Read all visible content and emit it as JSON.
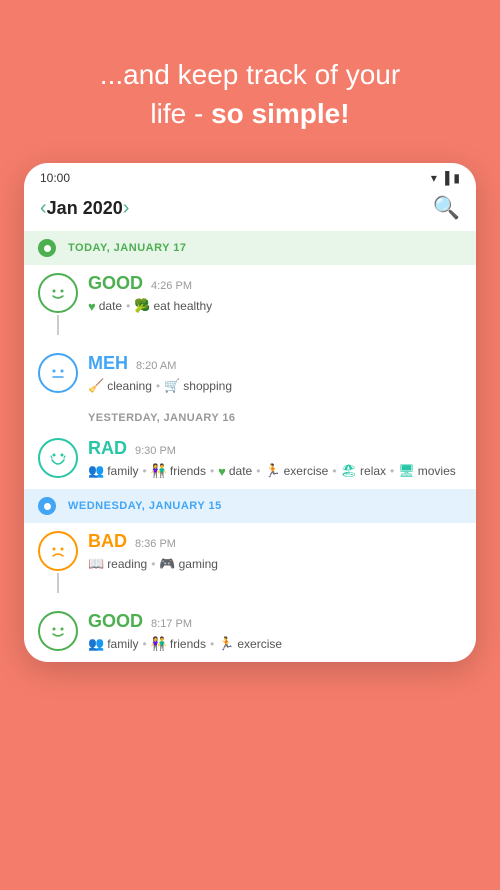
{
  "header": {
    "line1": "...and keep track of your",
    "line2_normal": "life - ",
    "line2_bold": "so simple!"
  },
  "statusBar": {
    "time": "10:00",
    "icons": [
      "wifi",
      "signal",
      "battery"
    ]
  },
  "navBar": {
    "prevLabel": "‹",
    "title": "Jan 2020",
    "nextLabel": "›",
    "searchIcon": "🔍"
  },
  "days": [
    {
      "id": "today",
      "type": "today",
      "label": "TODAY, JANUARY 17",
      "dotColor": "green",
      "entries": [
        {
          "mood": "GOOD",
          "moodClass": "good",
          "time": "4:26 PM",
          "tags": [
            {
              "icon": "♥",
              "iconClass": "green",
              "label": "date"
            },
            {
              "icon": "🥦",
              "iconClass": "green",
              "label": "eat healthy"
            }
          ],
          "hasConnector": true
        },
        {
          "mood": "MEH",
          "moodClass": "meh",
          "time": "8:20 AM",
          "tags": [
            {
              "icon": "🧹",
              "iconClass": "teal",
              "label": "cleaning"
            },
            {
              "icon": "🛒",
              "iconClass": "teal",
              "label": "shopping"
            }
          ],
          "hasConnector": false
        }
      ]
    },
    {
      "id": "yesterday",
      "type": "yesterday",
      "label": "YESTERDAY, JANUARY 16",
      "entries": [
        {
          "mood": "RAD",
          "moodClass": "rad",
          "time": "9:30 PM",
          "tags": [
            {
              "icon": "👥",
              "iconClass": "teal",
              "label": "family"
            },
            {
              "icon": "👫",
              "iconClass": "teal",
              "label": "friends"
            },
            {
              "icon": "♥",
              "iconClass": "green",
              "label": "date"
            },
            {
              "icon": "🏃",
              "iconClass": "teal",
              "label": "exercise"
            },
            {
              "icon": "🏖",
              "iconClass": "teal",
              "label": "relax"
            },
            {
              "icon": "🖥",
              "iconClass": "teal",
              "label": "movies"
            }
          ]
        }
      ]
    },
    {
      "id": "wednesday",
      "type": "wednesday",
      "label": "WEDNESDAY, JANUARY 15",
      "dotColor": "blue",
      "entries": [
        {
          "mood": "BAD",
          "moodClass": "bad",
          "time": "8:36 PM",
          "tags": [
            {
              "icon": "📖",
              "iconClass": "orange",
              "label": "reading"
            },
            {
              "icon": "🎮",
              "iconClass": "orange",
              "label": "gaming"
            }
          ],
          "hasConnector": true
        },
        {
          "mood": "GOOD",
          "moodClass": "good",
          "time": "8:17 PM",
          "tags": [
            {
              "icon": "👥",
              "iconClass": "green",
              "label": "family"
            },
            {
              "icon": "👫",
              "iconClass": "green",
              "label": "friends"
            },
            {
              "icon": "🏃",
              "iconClass": "green",
              "label": "exercise"
            }
          ],
          "hasConnector": false
        }
      ]
    }
  ]
}
